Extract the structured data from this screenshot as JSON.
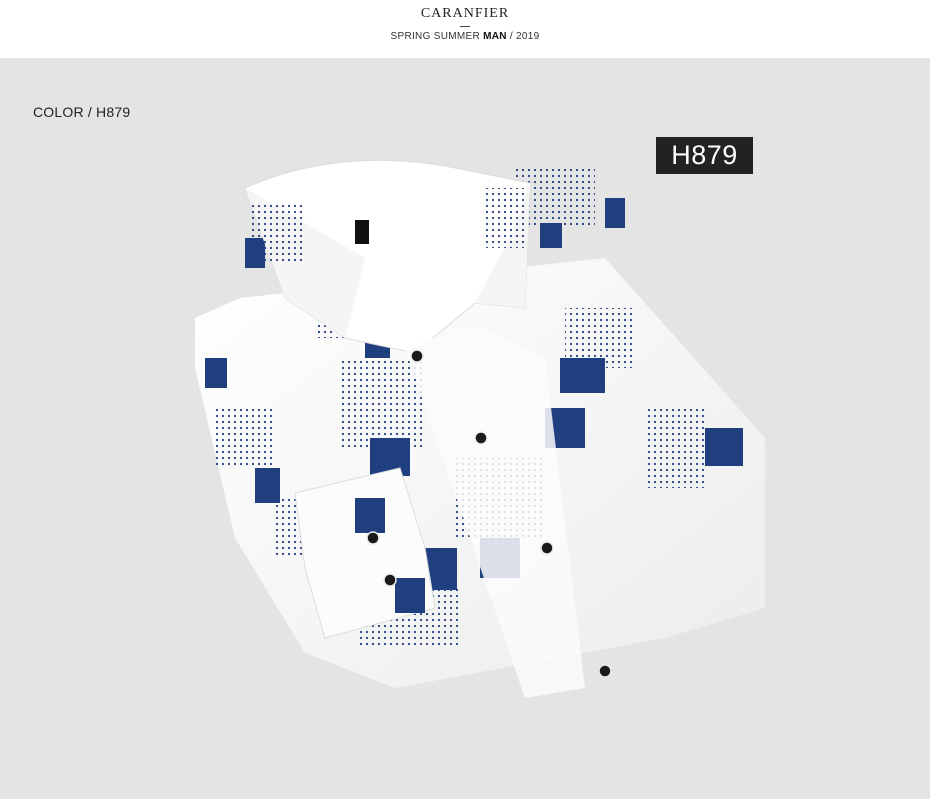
{
  "header": {
    "brand": "CARANFIER",
    "tagline_prefix": "SPRING SUMMER",
    "tagline_bold": "MAN",
    "tagline_suffix": "/ 2019"
  },
  "color_label": "COLOR / H879",
  "product_code": "H879",
  "product_image": {
    "subject": "folded long-sleeve shirt with navy square and dotted print",
    "colors": {
      "base": "#f8f8f8",
      "print": "#1f3f7f",
      "background": "#e4e4e4"
    }
  }
}
